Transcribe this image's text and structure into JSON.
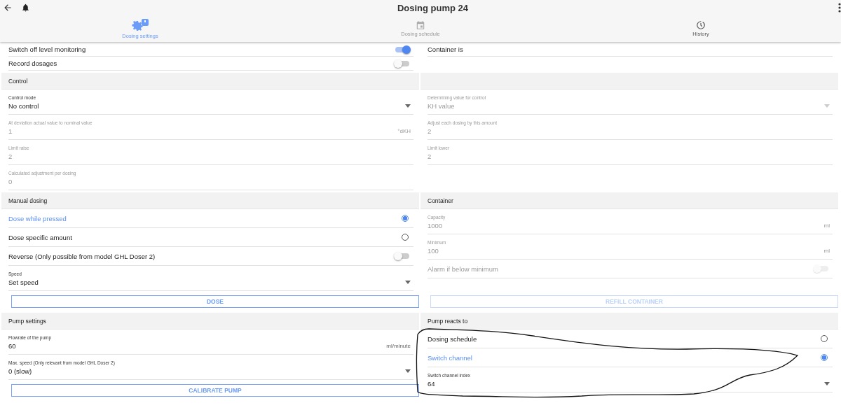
{
  "app_bar": {
    "title": "Dosing pump 24"
  },
  "tabs": [
    {
      "label": "Dosing settings",
      "selected": true,
      "disabled": false
    },
    {
      "label": "Dosing schedule",
      "selected": false,
      "disabled": true
    },
    {
      "label": "History",
      "selected": false,
      "disabled": false
    }
  ],
  "sections": [
    {
      "left": {
        "items": [
          {
            "kind": "toggle",
            "label": "Switch off level monitoring",
            "on": true,
            "disabled": false
          },
          {
            "kind": "toggle",
            "label": "Record dosages",
            "on": false,
            "disabled": false
          }
        ]
      },
      "right": {
        "items": [
          {
            "kind": "label",
            "label": "Container is"
          }
        ]
      }
    },
    {
      "left": {
        "header": "Control",
        "items": [
          {
            "kind": "select",
            "label": "Control mode",
            "value": "No control",
            "disabled": false
          },
          {
            "kind": "input",
            "label": "At deviation actual value to nominal value",
            "value": "1",
            "unit": "°dKH",
            "disabled": true
          },
          {
            "kind": "input",
            "label": "Limit raise",
            "value": "2",
            "disabled": true
          },
          {
            "kind": "input",
            "label": "Calculated adjustment per dosing",
            "value": "0",
            "disabled": true
          }
        ]
      },
      "right": {
        "items": [
          {
            "kind": "select",
            "label": "Determining value for control",
            "value": "KH value",
            "disabled": true
          },
          {
            "kind": "input",
            "label": "Adjust each dosing by this amount",
            "value": "2",
            "disabled": true
          },
          {
            "kind": "input",
            "label": "Limit lower",
            "value": "2",
            "disabled": true
          }
        ]
      }
    },
    {
      "left": {
        "header": "Manual dosing",
        "items": [
          {
            "kind": "radio",
            "label": "Dose while pressed",
            "selected": true
          },
          {
            "kind": "radio",
            "label": "Dose specific amount",
            "selected": false
          },
          {
            "kind": "toggle",
            "label": "Reverse (Only possible from model GHL Doser 2)",
            "on": false,
            "disabled": false
          },
          {
            "kind": "select",
            "label": "Speed",
            "value": "Set speed",
            "disabled": false
          },
          {
            "kind": "button",
            "label": "DOSE",
            "disabled": false
          }
        ]
      },
      "right": {
        "header": "Container",
        "items": [
          {
            "kind": "input",
            "label": "Capacity",
            "value": "1000",
            "unit": "ml",
            "disabled": true
          },
          {
            "kind": "input",
            "label": "Minimum",
            "value": "100",
            "unit": "ml",
            "disabled": true
          },
          {
            "kind": "toggle",
            "label": "Alarm if below minimum",
            "on": false,
            "disabled": true
          },
          {
            "kind": "button",
            "label": "REFILL CONTAINER",
            "disabled": true
          }
        ]
      }
    },
    {
      "left": {
        "header": "Pump settings",
        "items": [
          {
            "kind": "input",
            "label": "Flowrate of the pump",
            "value": "60",
            "unit": "ml/minute",
            "disabled": false
          },
          {
            "kind": "select",
            "label": "Max. speed (Only relevant from model GHL Doser 2)",
            "value": "0 (slow)",
            "disabled": false
          },
          {
            "kind": "button",
            "label": "CALIBRATE PUMP",
            "disabled": false
          }
        ]
      },
      "right": {
        "header": "Pump reacts to",
        "items": [
          {
            "kind": "radio",
            "label": "Dosing schedule",
            "selected": false
          },
          {
            "kind": "radio",
            "label": "Switch channel",
            "selected": true
          },
          {
            "kind": "select",
            "label": "Switch channel index",
            "value": "64",
            "disabled": false
          }
        ]
      }
    }
  ]
}
